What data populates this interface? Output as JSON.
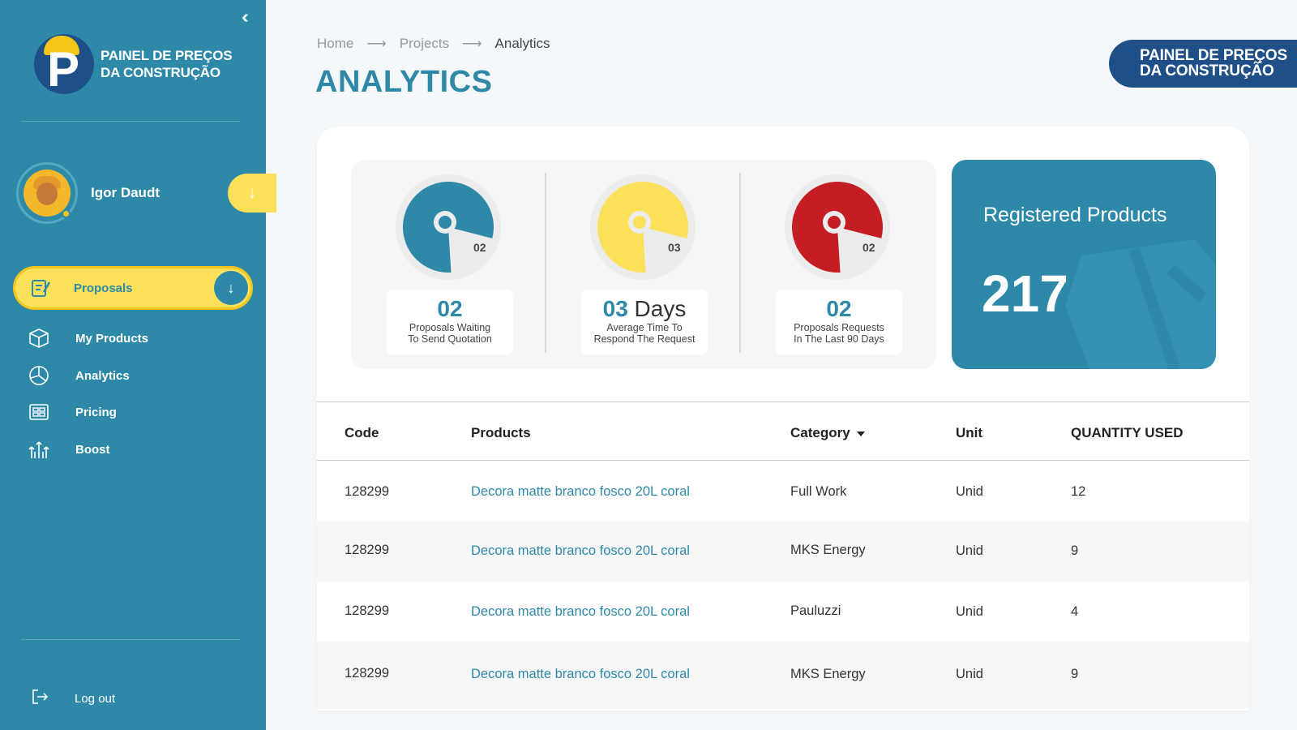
{
  "sidebar": {
    "collapse_icon": "double-chevron-left-icon",
    "logo_line1": "PAINEL DE PREÇOS",
    "logo_line2": "DA CONSTRUÇÃO",
    "logo_letter": "P",
    "user": {
      "name": "Igor Daudt",
      "toggle_glyph": "↓"
    },
    "active_item": {
      "label": "Proposals",
      "icon": "proposals-icon",
      "arrow_glyph": "↓"
    },
    "items": [
      {
        "label": "My Products",
        "icon": "box-icon"
      },
      {
        "label": "Analytics",
        "icon": "pie-chart-icon"
      },
      {
        "label": "Pricing",
        "icon": "pricing-icon"
      },
      {
        "label": "Boost",
        "icon": "boost-icon"
      }
    ],
    "logout_label": "Log out"
  },
  "header": {
    "breadcrumb": [
      "Home",
      "Projects",
      "Analytics"
    ],
    "breadcrumb_sep": "⟶",
    "title": "ANALYTICS",
    "brand_line1": "PAINEL DE PREÇOS",
    "brand_line2": "DA CONSTRUÇÃO"
  },
  "stats": [
    {
      "pie_label": "02",
      "value": "02",
      "suffix": "",
      "desc_line1": "Proposals Waiting",
      "desc_line2": "To Send Quotation",
      "color": "#2e88a8",
      "fill_fraction": 0.8
    },
    {
      "pie_label": "03",
      "value": "03",
      "suffix": " Days",
      "desc_line1": "Average Time To",
      "desc_line2": "Respond The Request",
      "color": "#fbe05a",
      "fill_fraction": 0.8
    },
    {
      "pie_label": "02",
      "value": "02",
      "suffix": "",
      "desc_line1": "Proposals Requests",
      "desc_line2": "In The Last 90 Days",
      "color": "#c41e24",
      "fill_fraction": 0.8
    }
  ],
  "registered": {
    "title": "Registered Products",
    "value": "217"
  },
  "table": {
    "headers": {
      "code": "Code",
      "products": "Products",
      "category": "Category",
      "unit": "Unit",
      "quantity": "QUANTITY USED"
    },
    "rows": [
      {
        "code": "128299",
        "product": "Decora matte branco fosco 20L coral",
        "category": "Full Work",
        "unit": "Unid",
        "quantity": "12"
      },
      {
        "code": "128299",
        "product": "Decora matte branco fosco 20L coral",
        "category": "MKS Energy",
        "unit": "Unid",
        "quantity": "9"
      },
      {
        "code": "128299",
        "product": "Decora matte branco fosco 20L coral",
        "category": "Pauluzzi",
        "unit": "Unid",
        "quantity": "4"
      },
      {
        "code": "128299",
        "product": "Decora matte branco fosco 20L coral",
        "category": "MKS Energy",
        "unit": "Unid",
        "quantity": "9"
      }
    ]
  }
}
